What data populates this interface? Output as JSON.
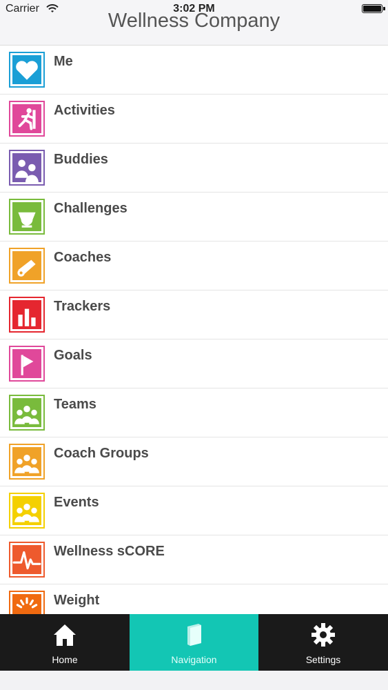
{
  "status_bar": {
    "carrier": "Carrier",
    "time": "3:02 PM"
  },
  "header": {
    "title": "Wellness Company"
  },
  "menu": [
    {
      "label": "Me",
      "icon": "heart-icon",
      "color": "#1a9fd6"
    },
    {
      "label": "Activities",
      "icon": "runner-icon",
      "color": "#e0489a"
    },
    {
      "label": "Buddies",
      "icon": "buddies-icon",
      "color": "#7a5cb0"
    },
    {
      "label": "Challenges",
      "icon": "trophy-icon",
      "color": "#79bb3c"
    },
    {
      "label": "Coaches",
      "icon": "whistle-icon",
      "color": "#f0a228"
    },
    {
      "label": "Trackers",
      "icon": "bar-chart-icon",
      "color": "#e5262f"
    },
    {
      "label": "Goals",
      "icon": "flag-icon",
      "color": "#e0489a"
    },
    {
      "label": "Teams",
      "icon": "team-icon",
      "color": "#79bb3c"
    },
    {
      "label": "Coach Groups",
      "icon": "group-icon",
      "color": "#f0a228"
    },
    {
      "label": "Events",
      "icon": "event-group-icon",
      "color": "#f4d000"
    },
    {
      "label": "Wellness sCORE",
      "icon": "pulse-icon",
      "color": "#ee5a2d"
    },
    {
      "label": "Weight",
      "icon": "scale-icon",
      "color": "#f06a10"
    }
  ],
  "tabs": [
    {
      "label": "Home",
      "icon": "home-icon",
      "active": false
    },
    {
      "label": "Navigation",
      "icon": "book-icon",
      "active": true
    },
    {
      "label": "Settings",
      "icon": "gear-icon",
      "active": false
    }
  ]
}
